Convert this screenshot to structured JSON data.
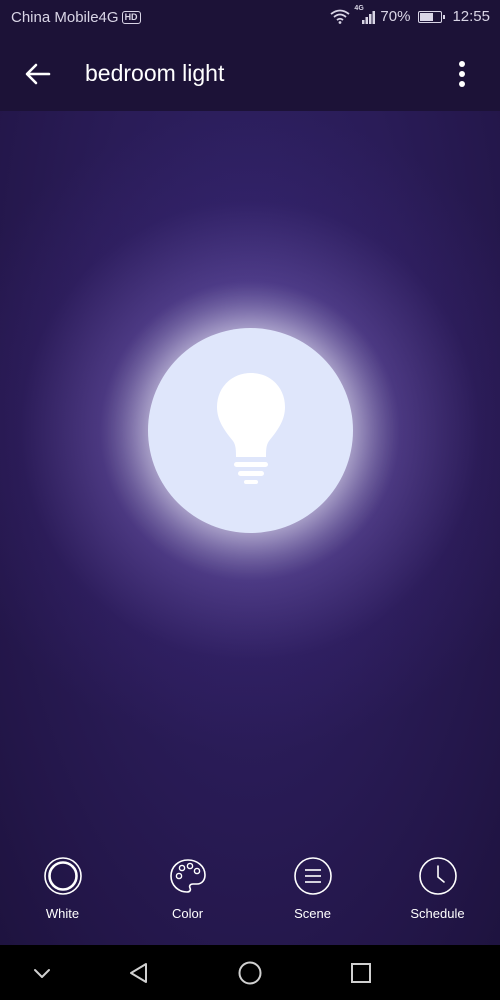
{
  "status_bar": {
    "carrier": "China Mobile4G",
    "hd_badge": "HD",
    "network_type": "4G",
    "battery_percent": "70%",
    "battery_level": 0.7,
    "time": "12:55"
  },
  "app_bar": {
    "title": "bedroom light",
    "back_icon": "arrow-left-icon",
    "more_icon": "more-vertical-icon"
  },
  "main": {
    "bulb_icon": "light-bulb-icon",
    "bulb_color": "#dfe6fb",
    "glow_color": "#ffffff",
    "background_color": "#25184a"
  },
  "modes": [
    {
      "label": "White",
      "icon": "circle-ring-icon"
    },
    {
      "label": "Color",
      "icon": "palette-icon"
    },
    {
      "label": "Scene",
      "icon": "scene-lines-icon"
    },
    {
      "label": "Schedule",
      "icon": "clock-icon"
    }
  ],
  "nav_bar": {
    "icons": [
      "chevron-down-icon",
      "back-triangle-icon",
      "home-circle-icon",
      "recents-square-icon"
    ]
  },
  "colors": {
    "bar_background": "#1c1237",
    "text_primary": "#ffffff",
    "status_text": "#d9d5e6"
  }
}
